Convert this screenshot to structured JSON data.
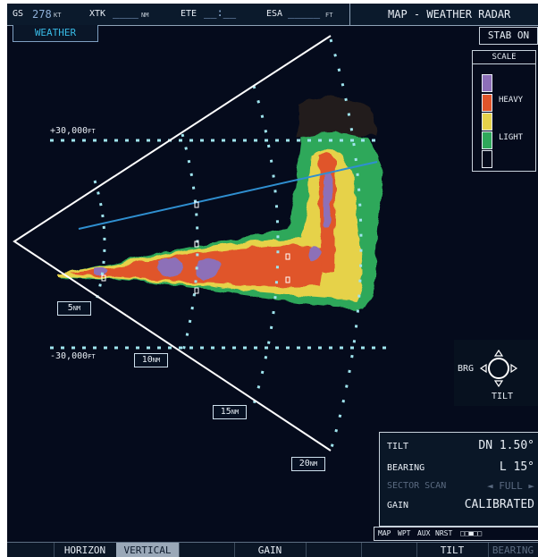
{
  "topbar": {
    "gs_label": "GS",
    "gs_value": "278",
    "gs_unit": "KT",
    "xtk_label": "XTK",
    "xtk_value": "____",
    "xtk_unit": "NM",
    "ete_label": "ETE",
    "ete_value": "__:__",
    "esa_label": "ESA",
    "esa_value": "_____",
    "esa_unit": "FT",
    "page_title": "MAP - WEATHER RADAR"
  },
  "mode_tab": "WEATHER",
  "stab_button": "STAB ON",
  "scale": {
    "title": "SCALE",
    "heavy_label": "HEAVY",
    "light_label": "LIGHT",
    "colors": [
      "#8d6fb8",
      "#e0542a",
      "#e6d24a",
      "#2fa85a",
      "#050b1c"
    ]
  },
  "altitudes": {
    "upper": "+30,000",
    "lower": "-30,000",
    "unit": "FT"
  },
  "ranges": [
    {
      "value": "5",
      "unit": "NM"
    },
    {
      "value": "10",
      "unit": "NM"
    },
    {
      "value": "15",
      "unit": "NM"
    },
    {
      "value": "20",
      "unit": "NM"
    }
  ],
  "bearing_control": {
    "brg_label": "BRG",
    "tilt_label": "TILT"
  },
  "info_panel": {
    "tilt_label": "TILT",
    "tilt_value": "DN 1.50°",
    "bearing_label": "BEARING",
    "bearing_value": "L 15°",
    "sector_label": "SECTOR SCAN",
    "sector_value": "◄ FULL ►",
    "gain_label": "GAIN",
    "gain_value": "CALIBRATED"
  },
  "navbar": {
    "items": [
      "MAP",
      "WPT",
      "AUX",
      "NRST"
    ],
    "page_indicator": "□□■□□"
  },
  "softkeys": {
    "horizon": "HORIZON",
    "vertical": "VERTICAL",
    "gain": "GAIN",
    "tilt": "TILT",
    "bearing": "BEARING"
  },
  "colors": {
    "background": "#050b1c",
    "accent_cyan": "#38b9e4",
    "beam_line": "#2f8fd0"
  }
}
